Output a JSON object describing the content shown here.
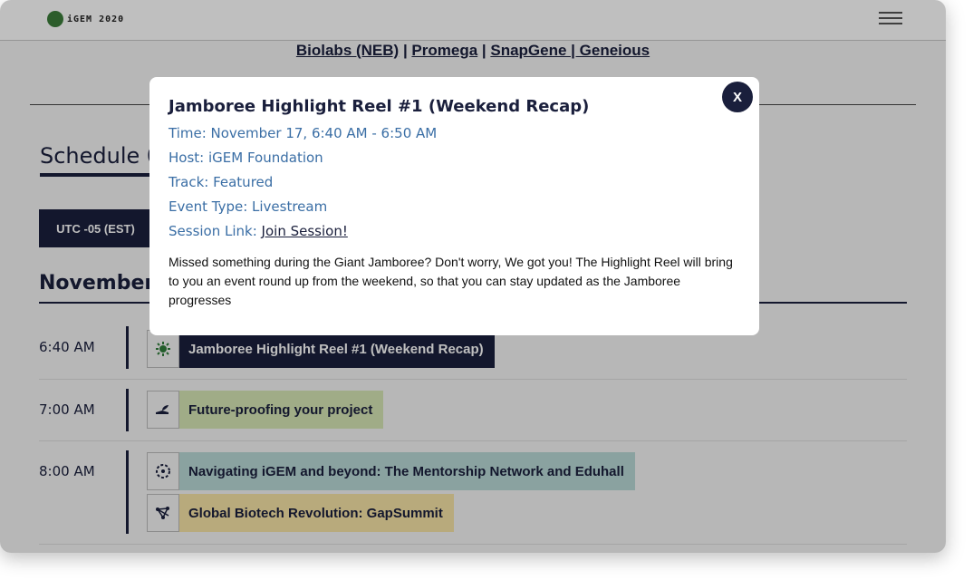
{
  "header": {
    "logo_text": "iGEM 2020",
    "menu_icon": "hamburger-icon"
  },
  "sponsors": {
    "neb": "Biolabs (NEB)",
    "sep1": " | ",
    "promega": "Promega",
    "sep2": " | ",
    "snapgene_geneious": "SnapGene | Geneious"
  },
  "schedule": {
    "title": "Schedule 0",
    "timezone_button": "UTC -05 (EST)",
    "day_title": "November 1"
  },
  "events": [
    {
      "time": "6:40 AM",
      "items": [
        {
          "title": "Jamboree Highlight Reel #1 (Weekend Recap)",
          "icon": "gear-sun-icon",
          "color": "#1a1f3c",
          "text_color": "#ffffff"
        }
      ]
    },
    {
      "time": "7:00 AM",
      "items": [
        {
          "title": "Future-proofing your project",
          "icon": "hand-plant-icon",
          "color": "#d6e6b5",
          "text_color": "#1a1f3c"
        }
      ]
    },
    {
      "time": "8:00 AM",
      "items": [
        {
          "title": "Navigating iGEM and beyond: The Mentorship Network and Eduhall",
          "icon": "network-circle-icon",
          "color": "#b8d8d6",
          "text_color": "#1a1f3c"
        },
        {
          "title": "Global Biotech Revolution: GapSummit",
          "icon": "molecule-icon",
          "color": "#f6e3a6",
          "text_color": "#1a1f3c"
        }
      ]
    }
  ],
  "modal": {
    "title": "Jamboree Highlight Reel #1 (Weekend Recap)",
    "time": "Time: November 17, 6:40 AM - 6:50 AM",
    "host": "Host: iGEM Foundation",
    "track": "Track: Featured",
    "event_type": "Event Type: Livestream",
    "session_label": "Session Link: ",
    "session_link": "Join Session!",
    "description": "Missed something during the Giant Jamboree? Don't worry, We got you! The Highlight Reel will bring to you an event round up from the weekend, so that you can stay updated as the Jamboree progresses",
    "close_label": "X"
  }
}
